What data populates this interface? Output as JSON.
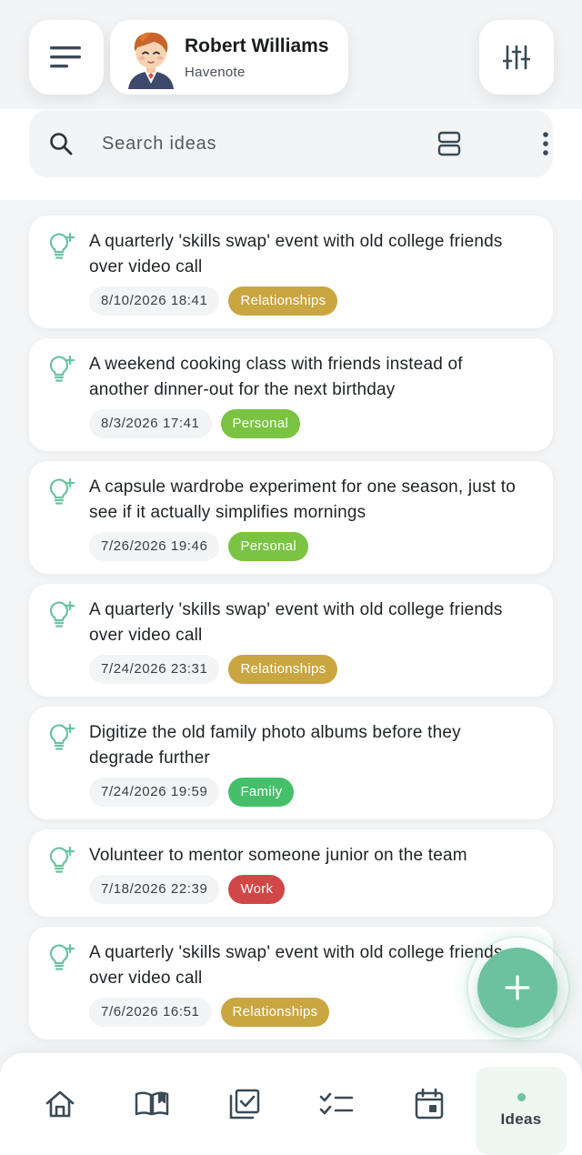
{
  "header": {
    "menu_icon": "menu-icon",
    "profile": {
      "name": "Robert Williams",
      "subtitle": "Havenote",
      "avatar_icon": "avatar-illustration"
    },
    "filter_icon": "sliders-icon"
  },
  "search": {
    "placeholder": "Search ideas",
    "value": "",
    "view_icon": "view-toggle-icon",
    "more_icon": "more-vertical-icon"
  },
  "ideas": [
    {
      "title": "A quarterly 'skills swap' event with old college friends over video call",
      "date": "8/10/2026 18:41",
      "tag": "Relationships",
      "tag_color": "#c9a640"
    },
    {
      "title": "A weekend cooking class with friends instead of another dinner-out for the next birthday",
      "date": "8/3/2026 17:41",
      "tag": "Personal",
      "tag_color": "#7bc342"
    },
    {
      "title": "A capsule wardrobe experiment for one season, just to see if it actually simplifies mornings",
      "date": "7/26/2026 19:46",
      "tag": "Personal",
      "tag_color": "#7bc342"
    },
    {
      "title": "A quarterly 'skills swap' event with old college friends over video call",
      "date": "7/24/2026 23:31",
      "tag": "Relationships",
      "tag_color": "#c9a640"
    },
    {
      "title": "Digitize the old family photo albums before they degrade further",
      "date": "7/24/2026 19:59",
      "tag": "Family",
      "tag_color": "#45bf6a"
    },
    {
      "title": "Volunteer to mentor someone junior on the team",
      "date": "7/18/2026 22:39",
      "tag": "Work",
      "tag_color": "#d14646"
    },
    {
      "title": "A quarterly 'skills swap' event with old college friends over video call",
      "date": "7/6/2026 16:51",
      "tag": "Relationships",
      "tag_color": "#c9a640"
    }
  ],
  "idea_icon": "lightbulb-sparkle-icon",
  "fab": {
    "icon": "plus-icon"
  },
  "colors": {
    "accent": "#6cc29f",
    "icon_dark": "#3b4a57"
  },
  "nav": {
    "items": [
      {
        "icon": "home-icon"
      },
      {
        "icon": "book-open-icon"
      },
      {
        "icon": "checkbox-icon"
      },
      {
        "icon": "checklist-icon"
      },
      {
        "icon": "calendar-icon"
      }
    ],
    "active_label": "Ideas"
  }
}
